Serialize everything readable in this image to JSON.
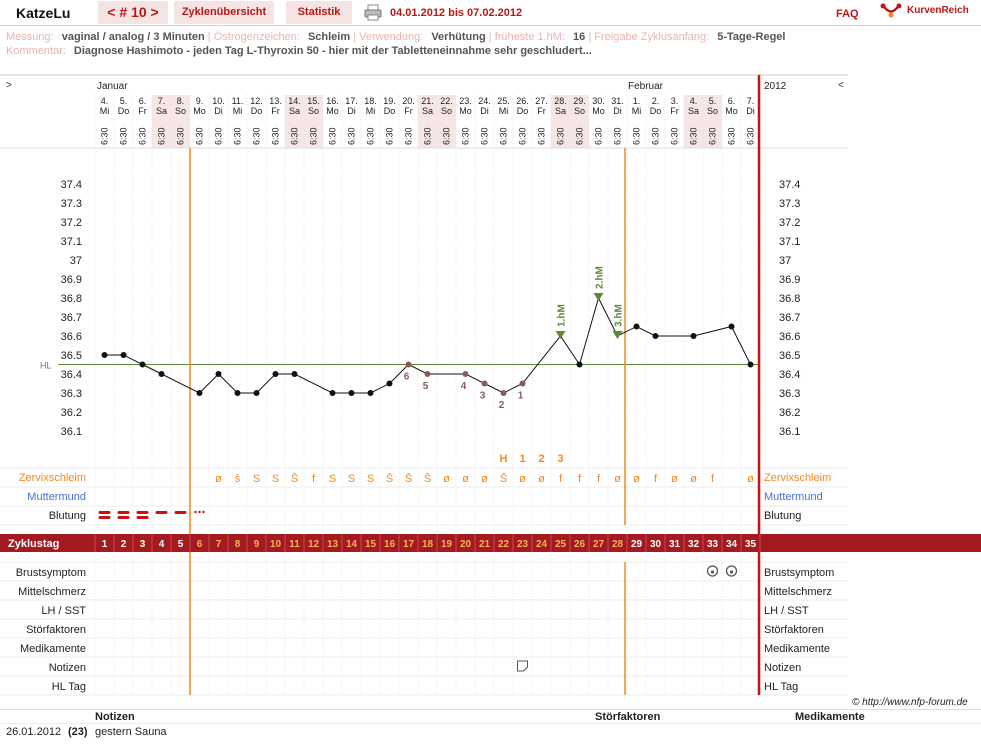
{
  "app": {
    "title": "KatzeLu",
    "cycle_nav": "< # 10 >",
    "tab_overview": "Zyklenübersicht",
    "tab_stats": "Statistik",
    "date_range": "04.01.2012 bis 07.02.2012",
    "faq": "FAQ",
    "logo": "KurvenReich"
  },
  "info": {
    "messung_label": "Messung:",
    "messung": "vaginal / analog / 3 Minuten",
    "oestrogen_label": "Östrogenzeichen:",
    "oestrogen": "Schleim",
    "verwendung_label": "Verwendung:",
    "verwendung": "Verhütung",
    "hm_label": "früheste 1.hM:",
    "hm": "16",
    "freigabe_label": "Freigabe Zyklusanfang:",
    "freigabe": "5-Tage-Regel",
    "kommentar_label": "Kommentar:",
    "kommentar": "Diagnose Hashimoto - jeden Tag L-Thyroxin 50 - hier mit der Tabletteneinnahme sehr geschludert..."
  },
  "chart_data": {
    "type": "line",
    "ylabel": "Temperatur",
    "ylim": [
      36.0,
      37.5
    ],
    "yticks": [
      "37.4",
      "37.3",
      "37.2",
      "37.1",
      "37",
      "36.9",
      "36.8",
      "36.7",
      "36.6",
      "36.5",
      "36.4",
      "36.3",
      "36.2",
      "36.1"
    ],
    "hl": 36.45,
    "hl_label": "HL",
    "months": [
      "Januar",
      "Februar"
    ],
    "year": "2012",
    "nav_left": ">",
    "nav_right": "<",
    "days": [
      {
        "d": "4.",
        "w": "Mi",
        "t": "6:30",
        "we": false
      },
      {
        "d": "5.",
        "w": "Do",
        "t": "6:30",
        "we": false
      },
      {
        "d": "6.",
        "w": "Fr",
        "t": "6:30",
        "we": false
      },
      {
        "d": "7.",
        "w": "Sa",
        "t": "6:30",
        "we": true
      },
      {
        "d": "8.",
        "w": "So",
        "t": "6:30",
        "we": true
      },
      {
        "d": "9.",
        "w": "Mo",
        "t": "6:30",
        "we": false
      },
      {
        "d": "10.",
        "w": "Di",
        "t": "6:30",
        "we": false
      },
      {
        "d": "11.",
        "w": "Mi",
        "t": "6:30",
        "we": false
      },
      {
        "d": "12.",
        "w": "Do",
        "t": "6:30",
        "we": false
      },
      {
        "d": "13.",
        "w": "Fr",
        "t": "6:30",
        "we": false
      },
      {
        "d": "14.",
        "w": "Sa",
        "t": "6:30",
        "we": true
      },
      {
        "d": "15.",
        "w": "So",
        "t": "6:30",
        "we": true
      },
      {
        "d": "16.",
        "w": "Mo",
        "t": "6:30",
        "we": false
      },
      {
        "d": "17.",
        "w": "Di",
        "t": "6:30",
        "we": false
      },
      {
        "d": "18.",
        "w": "Mi",
        "t": "6:30",
        "we": false
      },
      {
        "d": "19.",
        "w": "Do",
        "t": "6:30",
        "we": false
      },
      {
        "d": "20.",
        "w": "Fr",
        "t": "6:30",
        "we": false
      },
      {
        "d": "21.",
        "w": "Sa",
        "t": "6:30",
        "we": true
      },
      {
        "d": "22.",
        "w": "So",
        "t": "6:30",
        "we": true
      },
      {
        "d": "23.",
        "w": "Mo",
        "t": "6:30",
        "we": false
      },
      {
        "d": "24.",
        "w": "Di",
        "t": "6:30",
        "we": false
      },
      {
        "d": "25.",
        "w": "Mi",
        "t": "6:30",
        "we": false
      },
      {
        "d": "26.",
        "w": "Do",
        "t": "6:30",
        "we": false
      },
      {
        "d": "27.",
        "w": "Fr",
        "t": "6:30",
        "we": false
      },
      {
        "d": "28.",
        "w": "Sa",
        "t": "6:30",
        "we": true
      },
      {
        "d": "29.",
        "w": "So",
        "t": "6:30",
        "we": true
      },
      {
        "d": "30.",
        "w": "Mo",
        "t": "6:30",
        "we": false
      },
      {
        "d": "31.",
        "w": "Di",
        "t": "6:30",
        "we": false
      },
      {
        "d": "1.",
        "w": "Mi",
        "t": "6:30",
        "we": false
      },
      {
        "d": "2.",
        "w": "Do",
        "t": "6:30",
        "we": false
      },
      {
        "d": "3.",
        "w": "Fr",
        "t": "6:30",
        "we": false
      },
      {
        "d": "4.",
        "w": "Sa",
        "t": "6:30",
        "we": true
      },
      {
        "d": "5.",
        "w": "So",
        "t": "6:30",
        "we": true
      },
      {
        "d": "6.",
        "w": "Mo",
        "t": "6:30",
        "we": false
      },
      {
        "d": "7.",
        "w": "Di",
        "t": "6:30",
        "we": false
      }
    ],
    "temps": [
      36.5,
      36.5,
      36.45,
      36.4,
      null,
      36.3,
      36.4,
      36.3,
      36.3,
      36.4,
      36.4,
      null,
      36.3,
      36.3,
      36.3,
      36.35,
      36.45,
      36.4,
      null,
      36.4,
      36.35,
      36.3,
      36.35,
      null,
      36.6,
      36.45,
      36.8,
      36.6,
      36.65,
      36.6,
      null,
      36.6,
      null,
      36.65,
      36.45
    ],
    "counted_labels": {
      "16": "6",
      "17": "5",
      "19": "4",
      "20": "3",
      "21": "2",
      "22": "1"
    },
    "hm_markers": [
      {
        "day": 25,
        "label": "1.hM"
      },
      {
        "day": 27,
        "label": "2.hM"
      },
      {
        "day": 28,
        "label": "3.hM"
      }
    ],
    "peak_labels": [
      {
        "day": 22,
        "label": "H"
      },
      {
        "day": 23,
        "label": "1"
      },
      {
        "day": 24,
        "label": "2"
      },
      {
        "day": 25,
        "label": "3"
      }
    ],
    "cervix": [
      "",
      "",
      "",
      "",
      "",
      "",
      "ø",
      "s̄",
      "S",
      "S",
      "S̄",
      "f",
      "S",
      "S",
      "S",
      "S̄",
      "S̄",
      "S̄",
      "ø",
      "ø",
      "ø",
      "S̄",
      "ø",
      "ø",
      "f",
      "f",
      "f",
      "ø",
      "ø",
      "f",
      "ø",
      "ø",
      "f",
      "",
      "ø"
    ],
    "cycle_days": [
      "1",
      "2",
      "3",
      "4",
      "5",
      "6",
      "7",
      "8",
      "9",
      "10",
      "11",
      "12",
      "13",
      "14",
      "15",
      "16",
      "17",
      "18",
      "19",
      "20",
      "21",
      "22",
      "23",
      "24",
      "25",
      "26",
      "27",
      "28",
      "29",
      "30",
      "31",
      "32",
      "33",
      "34",
      "35"
    ]
  },
  "rows": {
    "cervix": "Zervixschleim",
    "muttermund": "Muttermund",
    "blutung": "Blutung",
    "zyklustag": "Zyklustag",
    "brust": "Brustsymptom",
    "mittel": "Mittelschmerz",
    "lh": "LH / SST",
    "stoer": "Störfaktoren",
    "medi": "Medikamente",
    "notizen": "Notizen",
    "hltag": "HL Tag"
  },
  "copyright": "© http://www.nfp-forum.de",
  "footer": {
    "notizen": "Notizen",
    "stoerfaktoren": "Störfaktoren",
    "medikamente": "Medikamente"
  },
  "notes": [
    {
      "date": "26.01.2012",
      "day": "(23)",
      "text": "gestern Sauna"
    }
  ],
  "colors": {
    "accent": "#b81818",
    "orange": "#f08a24",
    "green": "#5b8a3a",
    "blue": "#4a6fcf",
    "brown": "#8a5a5a"
  }
}
